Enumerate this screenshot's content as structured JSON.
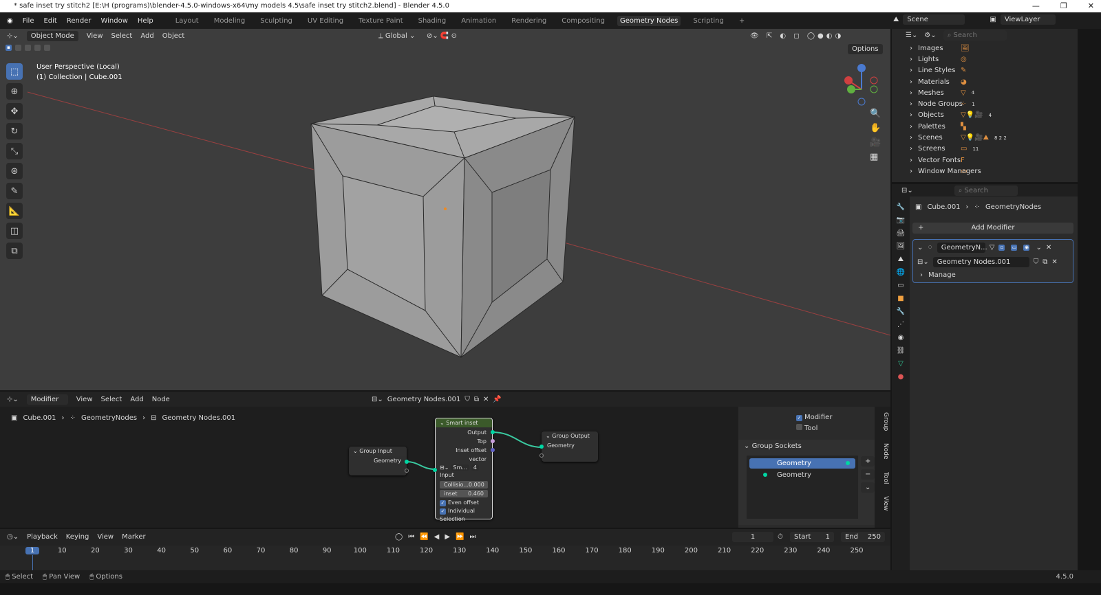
{
  "window": {
    "title": "* safe inset try stitch2 [E:\\H (programs)\\blender-4.5.0-windows-x64\\my models 4.5\\safe inset try stitch2.blend] - Blender 4.5.0",
    "controls": [
      "—",
      "❐",
      "✕"
    ]
  },
  "menu": [
    "File",
    "Edit",
    "Render",
    "Window",
    "Help"
  ],
  "workspaces": [
    {
      "label": "Layout"
    },
    {
      "label": "Modeling"
    },
    {
      "label": "Sculpting"
    },
    {
      "label": "UV Editing"
    },
    {
      "label": "Texture Paint"
    },
    {
      "label": "Shading"
    },
    {
      "label": "Animation"
    },
    {
      "label": "Rendering"
    },
    {
      "label": "Compositing"
    },
    {
      "label": "Geometry Nodes",
      "active": true
    },
    {
      "label": "Scripting"
    }
  ],
  "scene": {
    "label": "Scene",
    "view_layer": "ViewLayer"
  },
  "viewport": {
    "mode": "Object Mode",
    "menus": [
      "View",
      "Select",
      "Add",
      "Object"
    ],
    "orientation": "Global",
    "options": "Options",
    "info_line1": "User Perspective (Local)",
    "info_line2": "(1) Collection | Cube.001",
    "gizmo_axes": [
      "X",
      "Y",
      "Z"
    ]
  },
  "outliner": {
    "search_placeholder": "Search",
    "items": [
      {
        "label": "Images",
        "icon": "image-icon",
        "count": ""
      },
      {
        "label": "Lights",
        "icon": "light-icon",
        "count": ""
      },
      {
        "label": "Line Styles",
        "icon": "linestyle-icon",
        "count": ""
      },
      {
        "label": "Materials",
        "icon": "material-icon",
        "count": ""
      },
      {
        "label": "Meshes",
        "icon": "mesh-icon",
        "count": "4"
      },
      {
        "label": "Node Groups",
        "icon": "nodegroup-icon",
        "count": "1"
      },
      {
        "label": "Objects",
        "icon": "object-icon",
        "count": "4"
      },
      {
        "label": "Palettes",
        "icon": "palette-icon",
        "count": ""
      },
      {
        "label": "Scenes",
        "icon": "scene-icon",
        "count": "8 2 2"
      },
      {
        "label": "Screens",
        "icon": "screen-icon",
        "count": "11"
      },
      {
        "label": "Vector Fonts",
        "icon": "font-icon",
        "count": ""
      },
      {
        "label": "Window Managers",
        "icon": "wm-icon",
        "count": ""
      }
    ]
  },
  "properties": {
    "search_placeholder": "Search",
    "breadcrumb_object": "Cube.001",
    "breadcrumb_modifier": "GeometryNodes",
    "add_modifier": "Add Modifier",
    "modifier_name": "GeometryN...",
    "node_group": "Geometry Nodes.001",
    "manage": "Manage"
  },
  "node_editor": {
    "type": "Modifier",
    "menus": [
      "View",
      "Select",
      "Add",
      "Node"
    ],
    "node_group": "Geometry Nodes.001",
    "breadcrumb": [
      "Cube.001",
      "GeometryNodes",
      "Geometry Nodes.001"
    ],
    "group_input": {
      "title": "Group Input",
      "output": "Geometry"
    },
    "group_output": {
      "title": "Group Output",
      "input": "Geometry"
    },
    "smart_inset": {
      "title": "Smart inset",
      "outputs": [
        "Output",
        "Top",
        "Inset offset vector"
      ],
      "group_name": "Sm...",
      "users": "4",
      "input": "Input",
      "collision_label": "Collisio...",
      "collision_value": "0.000",
      "inset_label": "inset",
      "inset_value": "0.460",
      "even_offset": "Even offset",
      "individual": "Individual",
      "selection": "Selection",
      "header_color": "#3b5a2a"
    },
    "sidebar": {
      "modifier": "Modifier",
      "modifier_checked": true,
      "tool": "Tool",
      "tool_checked": false,
      "group_sockets": "Group Sockets",
      "sockets": [
        "Geometry",
        "Geometry"
      ],
      "tabs": [
        "Group",
        "Node",
        "Tool",
        "View"
      ]
    }
  },
  "timeline": {
    "menus": [
      "Playback",
      "Keying",
      "View",
      "Marker"
    ],
    "current_frame": "1",
    "start_label": "Start",
    "start": "1",
    "end_label": "End",
    "end": "250",
    "ticks": [
      "1",
      "10",
      "20",
      "30",
      "40",
      "50",
      "60",
      "70",
      "80",
      "90",
      "100",
      "110",
      "120",
      "130",
      "140",
      "150",
      "160",
      "170",
      "180",
      "190",
      "200",
      "210",
      "220",
      "230",
      "240",
      "250"
    ]
  },
  "statusbar": {
    "items": [
      "Select",
      "Pan View",
      "Options"
    ],
    "version": "4.5.0"
  },
  "colors": {
    "accent": "#4772b3",
    "geometry_socket": "#00d6a3",
    "viewport_bg": "#3d3d3d"
  }
}
